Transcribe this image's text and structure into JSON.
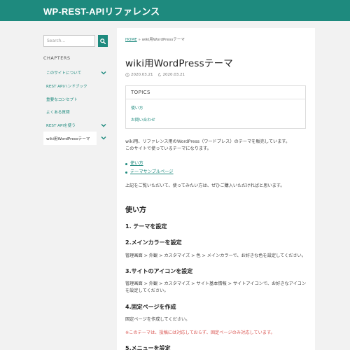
{
  "header": {
    "title": "WP-REST-APIリファレンス"
  },
  "sidebar": {
    "search_placeholder": "Search...",
    "chapters_label": "CHAPTERS",
    "items": [
      {
        "label": "このサイトについて"
      },
      {
        "label": "REST APIハンドブック"
      },
      {
        "label": "重要なコンセプト"
      },
      {
        "label": "よくある質問"
      },
      {
        "label": "REST APIを使う"
      },
      {
        "label": "wiki用WordPressテーマ"
      }
    ]
  },
  "main": {
    "breadcrumb_home": "HOME",
    "breadcrumb_sep": "»",
    "breadcrumb_current": "wiki用WordPressテーマ",
    "title": "wiki用WordPressテーマ",
    "published": "2020.03.21",
    "updated": "2020.03.21",
    "topics": {
      "heading": "TOPICS",
      "links": [
        "使い方",
        "お問い合わせ"
      ]
    },
    "intro_line1": "wiki用、リファレンス用のWordPress（ワードプレス）のテーマを販売しています。",
    "intro_line2": "このサイトで使っているテーマになります。",
    "links": [
      "使い方",
      "テーマサンプルページ"
    ],
    "note": "上記をご覧いただいて、使ってみたい方は、ぜひご購入いただければと思います。",
    "section_heading": "使い方",
    "steps": [
      {
        "heading": "1. テーマを設定",
        "text": ""
      },
      {
        "heading": "2.メインカラーを設定",
        "text": "管理画面 > 外観 > カスタマイズ > 色 > メインカラーで、お好きな色を設定してください。"
      },
      {
        "heading": "3.サイトのアイコンを設定",
        "text": "管理画面 > 外観 > カスタマイズ > サイト基本情報 > サイトアイコンで、お好きなアイコンを設定してください。"
      },
      {
        "heading": "4.固定ページを作成",
        "text": "固定ページを作成してください。"
      },
      {
        "heading": "5.メニューを設定",
        "text": ""
      }
    ],
    "warning": "※このテーマは、投稿には対応しておらず、固定ページのみ対応しています。"
  },
  "colors": {
    "accent": "#1e8a7e",
    "warning": "#d9534f",
    "background": "#f2f2f2"
  }
}
